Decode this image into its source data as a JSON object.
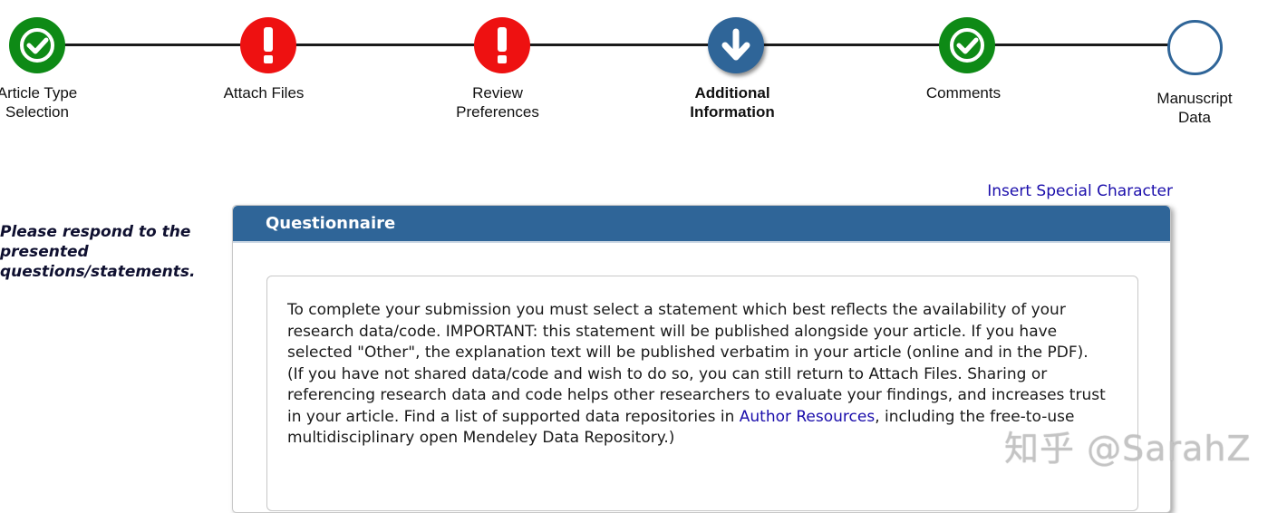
{
  "steps": [
    {
      "lines": [
        "Article Type",
        "Selection"
      ],
      "status": "done"
    },
    {
      "lines": [
        "Attach Files"
      ],
      "status": "error"
    },
    {
      "lines": [
        "Review",
        "Preferences"
      ],
      "status": "error"
    },
    {
      "lines": [
        "Additional",
        "Information"
      ],
      "status": "current"
    },
    {
      "lines": [
        "Comments"
      ],
      "status": "done"
    },
    {
      "lines": [
        "Manuscript",
        "Data"
      ],
      "status": "pending"
    }
  ],
  "insert_special_character": "Insert Special Character",
  "instruction": "Please respond to the presented questions/statements.",
  "panel": {
    "title": "Questionnaire",
    "paragraph1": "To complete your submission you must select a statement which best reflects the availability of your research data/code. IMPORTANT: this statement will be published alongside your article. If you have selected \"Other\", the explanation text will be published verbatim in your article (online and in the PDF).",
    "paragraph2_before": "(If you have not shared data/code and wish to do so, you can still return to Attach Files. Sharing or referencing research data and code helps other researchers to evaluate your findings, and increases trust in your article. Find a list of supported data repositories in ",
    "author_resources_link": "Author Resources",
    "paragraph2_after": ", including the free-to-use multidisciplinary open Mendeley Data Repository.)"
  },
  "watermark": "知乎 @SarahZ",
  "colors": {
    "done": "#0e8a16",
    "error": "#ee1111",
    "current": "#2f6598",
    "link": "#1a0dab"
  }
}
